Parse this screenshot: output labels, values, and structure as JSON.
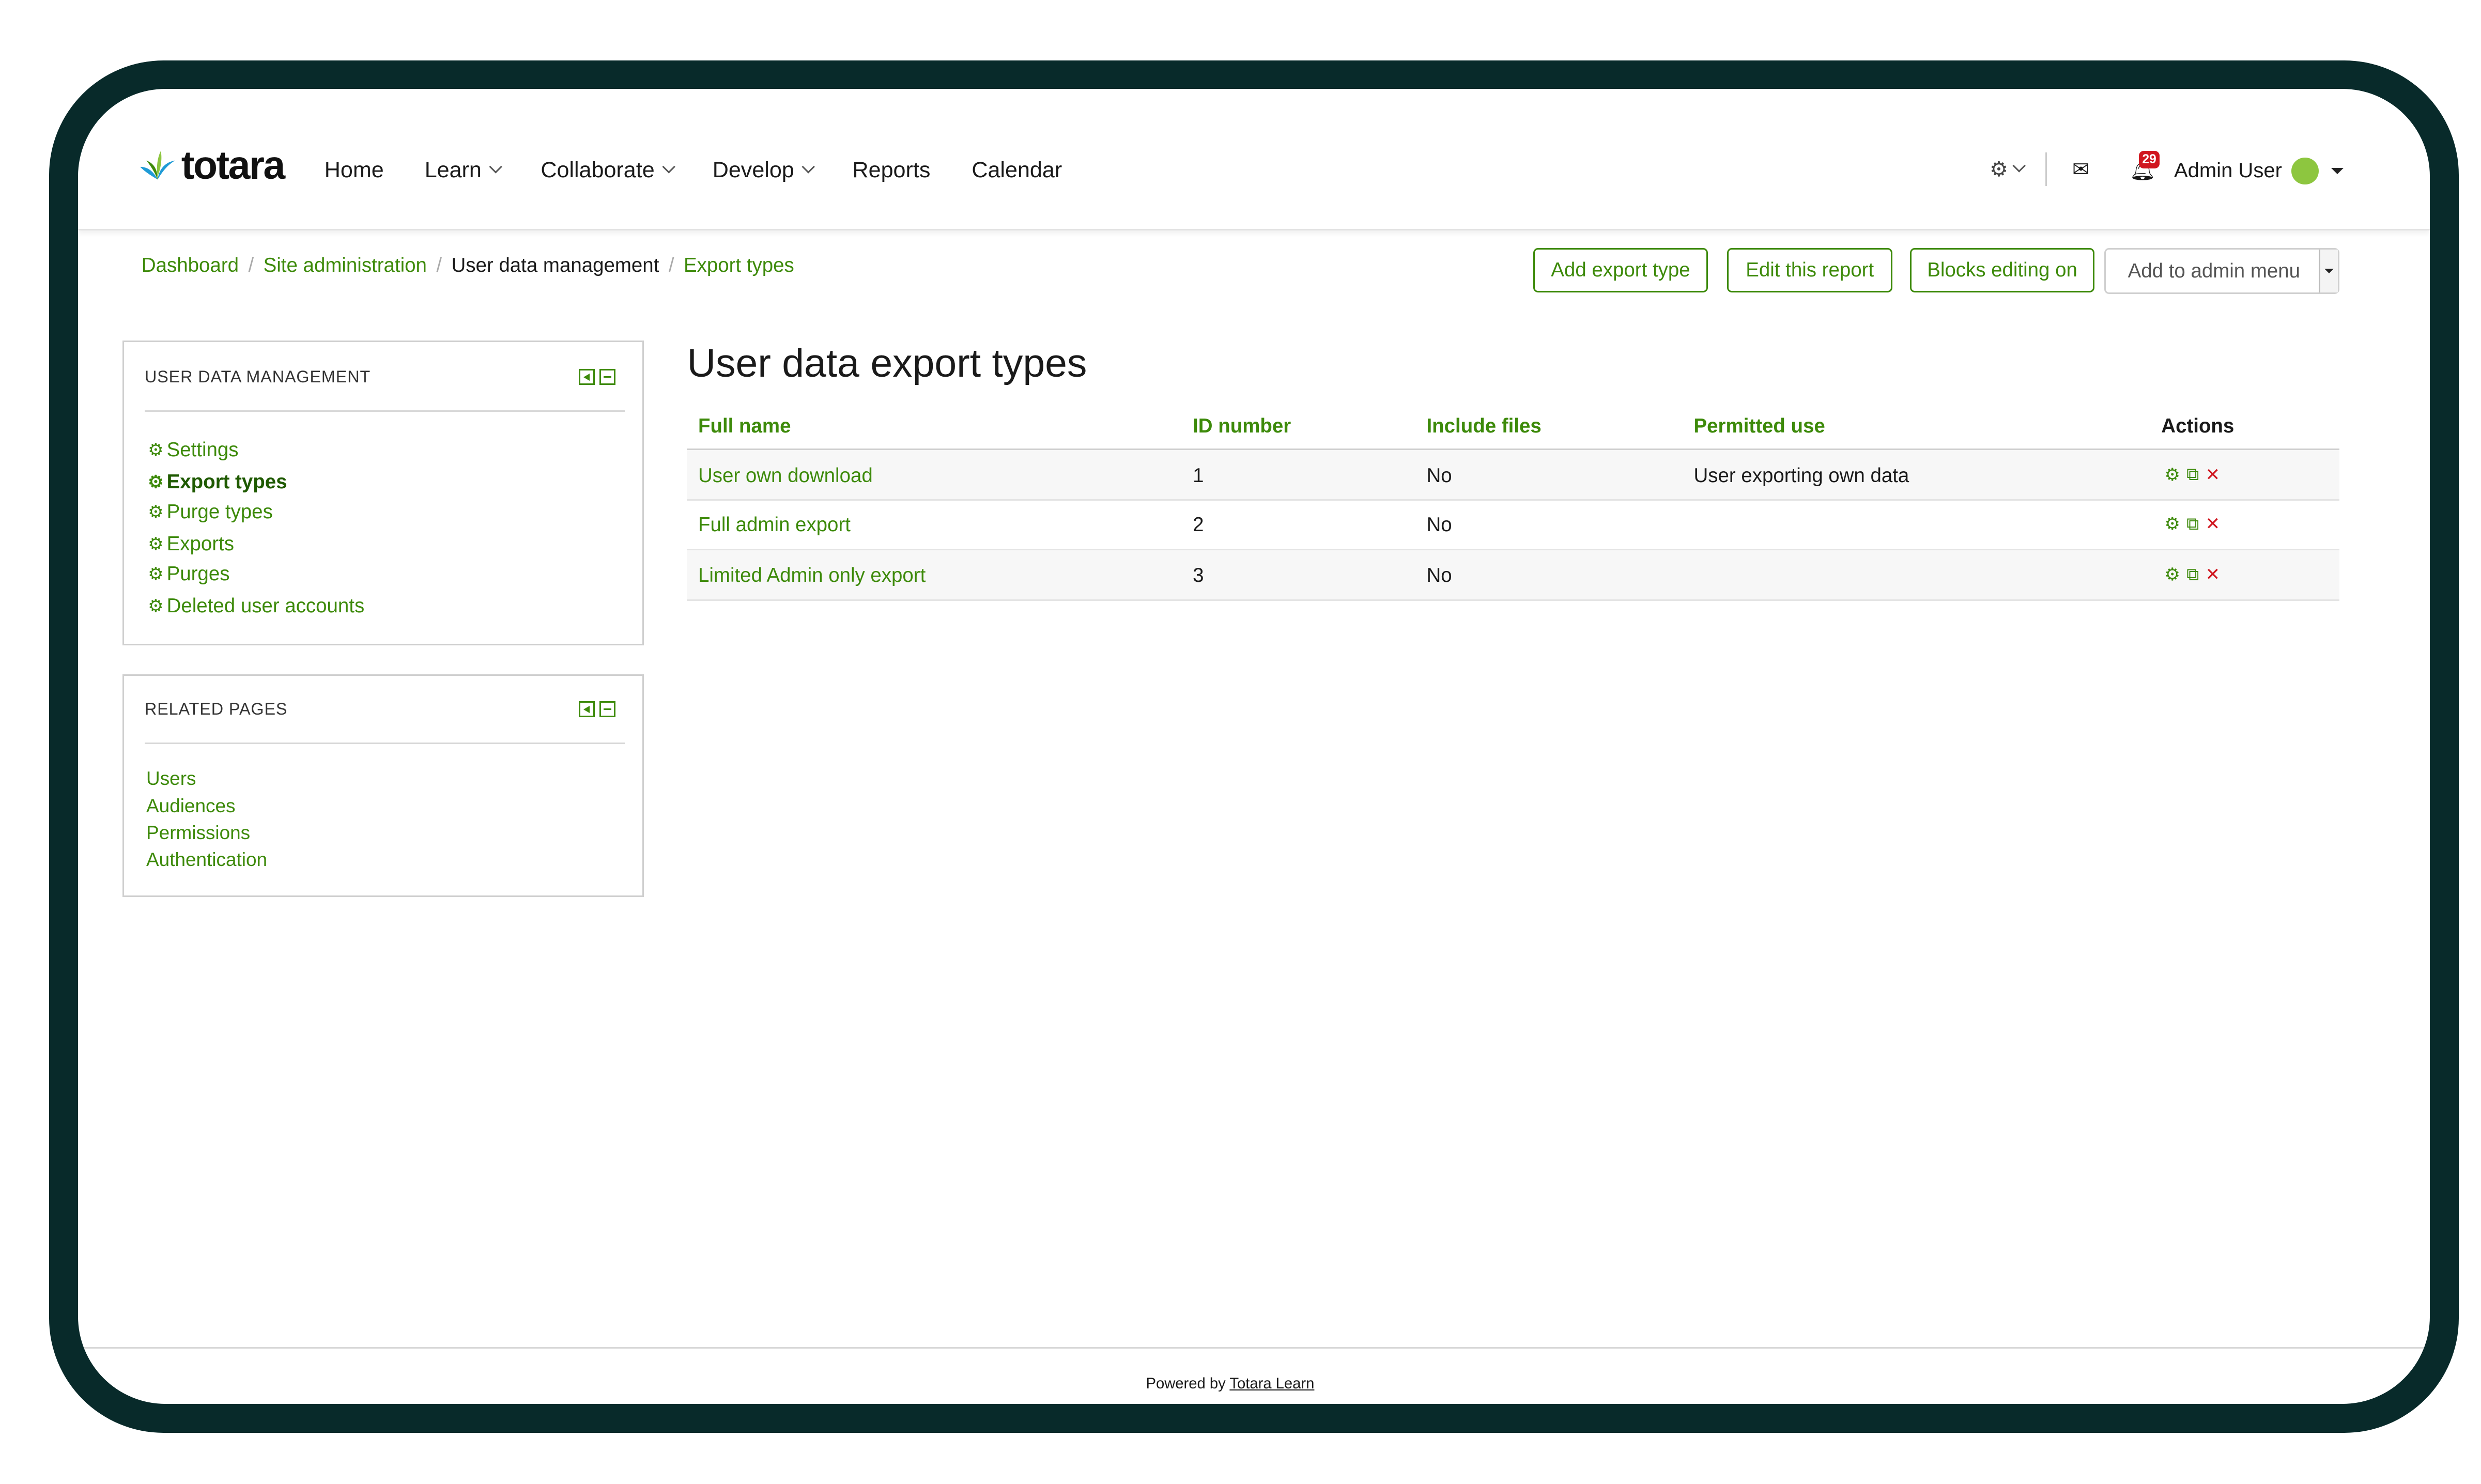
{
  "brand": {
    "name": "totara"
  },
  "nav": {
    "items": [
      {
        "label": "Home"
      },
      {
        "label": "Learn"
      },
      {
        "label": "Collaborate"
      },
      {
        "label": "Develop"
      },
      {
        "label": "Reports"
      },
      {
        "label": "Calendar"
      }
    ],
    "notifications_count": "29",
    "user_name": "Admin User"
  },
  "breadcrumb": [
    {
      "label": "Dashboard"
    },
    {
      "label": "Site administration"
    },
    {
      "label": "User data management"
    },
    {
      "label": "Export types"
    }
  ],
  "actions": {
    "add_export_type": "Add export type",
    "edit_report": "Edit this report",
    "blocks_editing": "Blocks editing on",
    "admin_menu_placeholder": "Add to admin menu"
  },
  "sidebar": {
    "user_data": {
      "title": "USER DATA MANAGEMENT",
      "items": [
        {
          "label": "Settings"
        },
        {
          "label": "Export types"
        },
        {
          "label": "Purge types"
        },
        {
          "label": "Exports"
        },
        {
          "label": "Purges"
        },
        {
          "label": "Deleted user accounts"
        }
      ]
    },
    "related": {
      "title": "RELATED PAGES",
      "items": [
        {
          "label": "Users"
        },
        {
          "label": "Audiences"
        },
        {
          "label": "Permissions"
        },
        {
          "label": "Authentication"
        }
      ]
    }
  },
  "main": {
    "title": "User data export types",
    "columns": [
      "Full name",
      "ID number",
      "Include files",
      "Permitted use",
      "Actions"
    ],
    "rows": [
      {
        "name": "User own download",
        "id": "1",
        "include_files": "No",
        "permitted_use": "User exporting own data"
      },
      {
        "name": "Full admin export",
        "id": "2",
        "include_files": "No",
        "permitted_use": ""
      },
      {
        "name": "Limited Admin only export",
        "id": "3",
        "include_files": "No",
        "permitted_use": ""
      }
    ]
  },
  "footer": {
    "prefix": "Powered by",
    "link": "Totara Learn"
  },
  "colors": {
    "accent": "#3d8a0a",
    "frame": "#082a2a",
    "badge": "#d0161f"
  }
}
